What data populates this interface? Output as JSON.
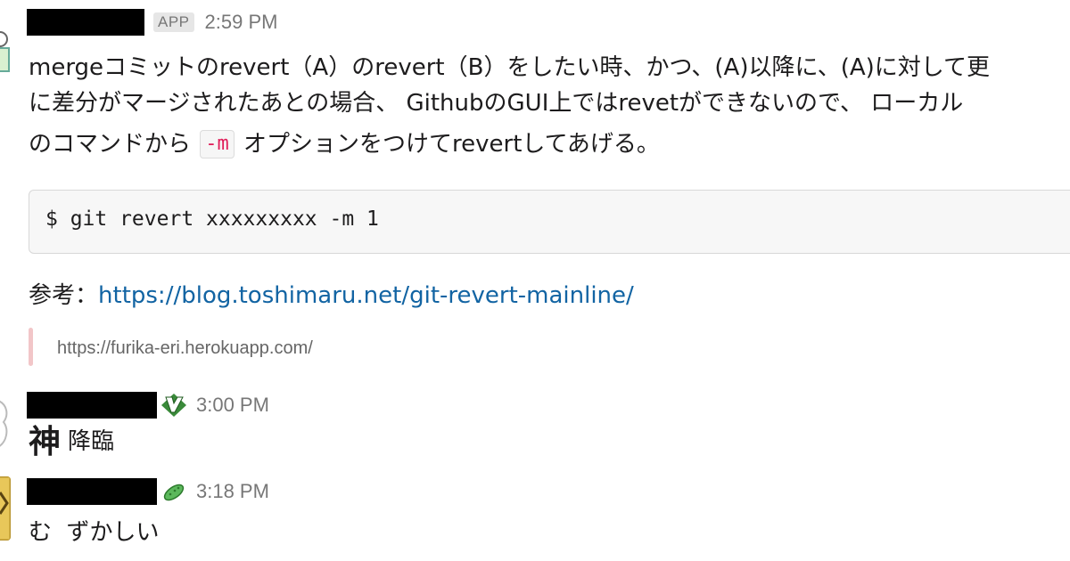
{
  "messages": [
    {
      "app_badge": "APP",
      "time": "2:59 PM",
      "lines": [
        "mergeコミットのrevert（A）のrevert（B）をしたい時、かつ、(A)以降に、(A)に対して更",
        "に差分がマージされたあとの場合、 GithubのGUI上ではrevetができないので、 ローカル",
        "のコマンドから"
      ],
      "inline_code": "-m",
      "line3_suffix": "オプションをつけてrevertしてあげる。",
      "code_block": "$ git revert xxxxxxxxx -m 1",
      "ref_label": "参考：",
      "ref_link": "https://blog.toshimaru.net/git-revert-mainline/",
      "unfurl_url": "https://furika-eri.herokuapp.com/"
    },
    {
      "time": "3:00 PM",
      "status_icon": "vim-icon",
      "emoji_text": "神",
      "text": "降臨"
    },
    {
      "time": "3:18 PM",
      "status_icon": "cucumber-icon",
      "text": "む  ずかしい"
    }
  ],
  "colors": {
    "link": "#1264a3",
    "inline_code": "#e01e5a",
    "timestamp": "#777777",
    "unfurl_bar": "#f2c6c8",
    "code_bg": "#f7f7f7"
  }
}
